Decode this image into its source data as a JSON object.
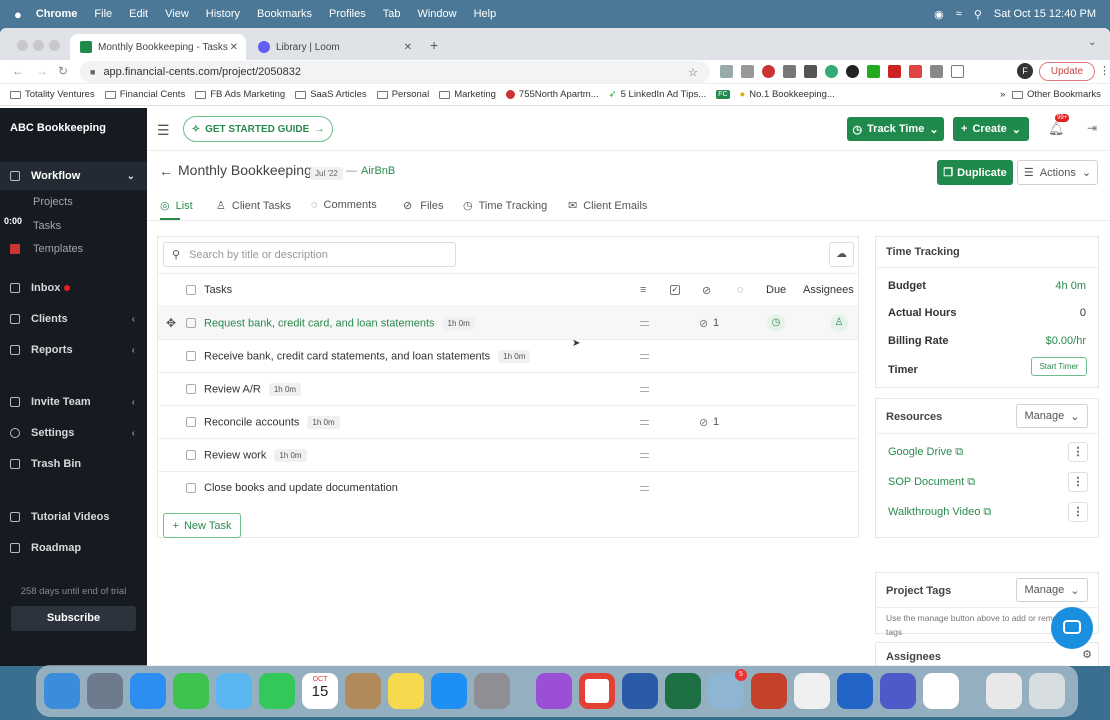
{
  "menubar": {
    "apple": "",
    "app": "Chrome",
    "items": [
      "File",
      "Edit",
      "View",
      "History",
      "Bookmarks",
      "Profiles",
      "Tab",
      "Window",
      "Help"
    ],
    "clock": "Sat Oct 15  12:40 PM"
  },
  "browser": {
    "tabs": [
      {
        "title": "Monthly Bookkeeping - Tasks",
        "favicon_color": "#1f8a4c"
      },
      {
        "title": "Library | Loom",
        "favicon_color": "#625df5"
      }
    ],
    "url": "app.financial-cents.com/project/2050832",
    "update_label": "Update",
    "profile_initial": "F",
    "bookmarks": [
      "Totality Ventures",
      "Financial Cents",
      "FB Ads Marketing",
      "SaaS Articles",
      "Personal",
      "Marketing",
      "755North Apartm...",
      "5 LinkedIn Ad Tips...",
      "FC",
      "No.1 Bookkeeping..."
    ],
    "other_bookmarks": "Other Bookmarks"
  },
  "sidebar": {
    "brand": "ABC Bookkeeping",
    "workflow": "Workflow",
    "sub": [
      "Projects",
      "Tasks",
      "Templates"
    ],
    "timer_overlay": "0:00",
    "items": [
      "Inbox",
      "Clients",
      "Reports",
      "Invite Team",
      "Settings",
      "Trash Bin",
      "Tutorial Videos",
      "Roadmap"
    ],
    "trial_text": "258 days until end of trial",
    "subscribe": "Subscribe"
  },
  "header": {
    "getting_started": "GET STARTED GUIDE",
    "track_time": "Track Time",
    "create": "Create",
    "notif_count": "99+"
  },
  "project": {
    "title": "Monthly Bookkeeping",
    "period": "Jul '22",
    "dash": "—",
    "client": "AirBnB",
    "duplicate": "Duplicate",
    "actions": "Actions",
    "tabs": [
      "List",
      "Client Tasks",
      "Comments",
      "Files",
      "Time Tracking",
      "Client Emails"
    ]
  },
  "task_list": {
    "search_placeholder": "Search by title or description",
    "col_tasks": "Tasks",
    "col_due": "Due",
    "col_assignees": "Assignees",
    "rows": [
      {
        "name": "Request bank, credit card, and loan statements",
        "time": "1h 0m",
        "files": "1"
      },
      {
        "name": "Receive bank, credit card statements, and loan statements",
        "time": "1h 0m",
        "files": ""
      },
      {
        "name": "Review A/R",
        "time": "1h 0m",
        "files": ""
      },
      {
        "name": "Reconcile accounts",
        "time": "1h 0m",
        "files": "1"
      },
      {
        "name": "Review work",
        "time": "1h 0m",
        "files": ""
      },
      {
        "name": "Close books and update documentation",
        "time": "",
        "files": ""
      }
    ],
    "new_task": "New Task"
  },
  "time_tracking": {
    "title": "Time Tracking",
    "budget_label": "Budget",
    "budget": "4h 0m",
    "actual_label": "Actual Hours",
    "actual": "0",
    "rate_label": "Billing Rate",
    "rate": "$0.00/hr",
    "timer_label": "Timer",
    "start_timer": "Start Timer"
  },
  "resources": {
    "title": "Resources",
    "manage": "Manage",
    "links": [
      "Google Drive",
      "SOP Document",
      "Walkthrough Video"
    ]
  },
  "tags": {
    "title": "Project Tags",
    "manage": "Manage",
    "hint": "Use the manage button above to add or remove tags"
  },
  "assignees": {
    "title": "Assignees"
  },
  "dock": {
    "calendar_month": "OCT",
    "calendar_day": "15",
    "mail_badge": "5"
  },
  "colors": {
    "brand_green": "#1f8a4c",
    "link_green": "#2a8a4e",
    "sidebar_bg": "#161b22"
  }
}
